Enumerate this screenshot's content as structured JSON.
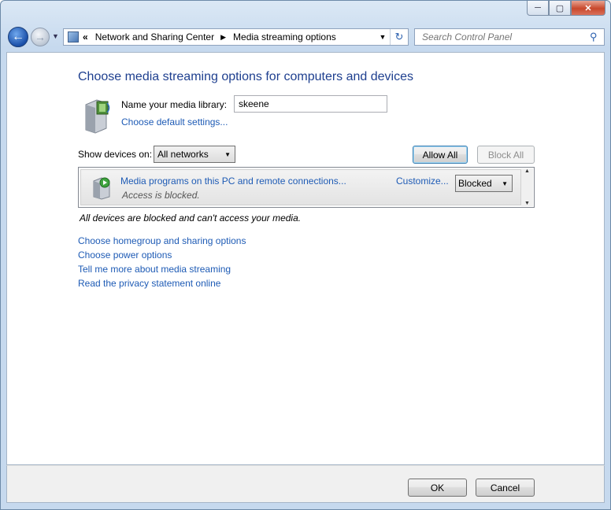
{
  "window": {
    "minimize_glyph": "─",
    "maximize_glyph": "▢",
    "close_glyph": "✕"
  },
  "nav": {
    "back_glyph": "←",
    "forward_glyph": "→",
    "recent_glyph": "▼",
    "breadcrumb_overflow": "«",
    "breadcrumbs": [
      "Network and Sharing Center",
      "Media streaming options"
    ],
    "crumb_separator": "▶",
    "address_dropdown_glyph": "▼",
    "refresh_glyph": "↻",
    "search_placeholder": "Search Control Panel",
    "search_glyph": "⚲"
  },
  "main": {
    "title": "Choose media streaming options for computers and devices",
    "library_label": "Name your media library:",
    "library_value": "skeene",
    "choose_default_link": "Choose default settings...",
    "show_devices_label": "Show devices on:",
    "show_devices_value": "All networks",
    "allow_all_label": "Allow All",
    "block_all_label": "Block All",
    "device": {
      "name": "Media programs on this PC and remote connections...",
      "status": "Access is blocked.",
      "customize_link": "Customize...",
      "access_value": "Blocked"
    },
    "note": "All devices are blocked and can't access your media.",
    "links": [
      "Choose homegroup and sharing options",
      "Choose power options",
      "Tell me more about media streaming",
      "Read the privacy statement online"
    ]
  },
  "footer": {
    "ok_label": "OK",
    "cancel_label": "Cancel"
  },
  "colors": {
    "link": "#1e5bb5",
    "title": "#1e3f8f",
    "close_button": "#c8482c"
  }
}
